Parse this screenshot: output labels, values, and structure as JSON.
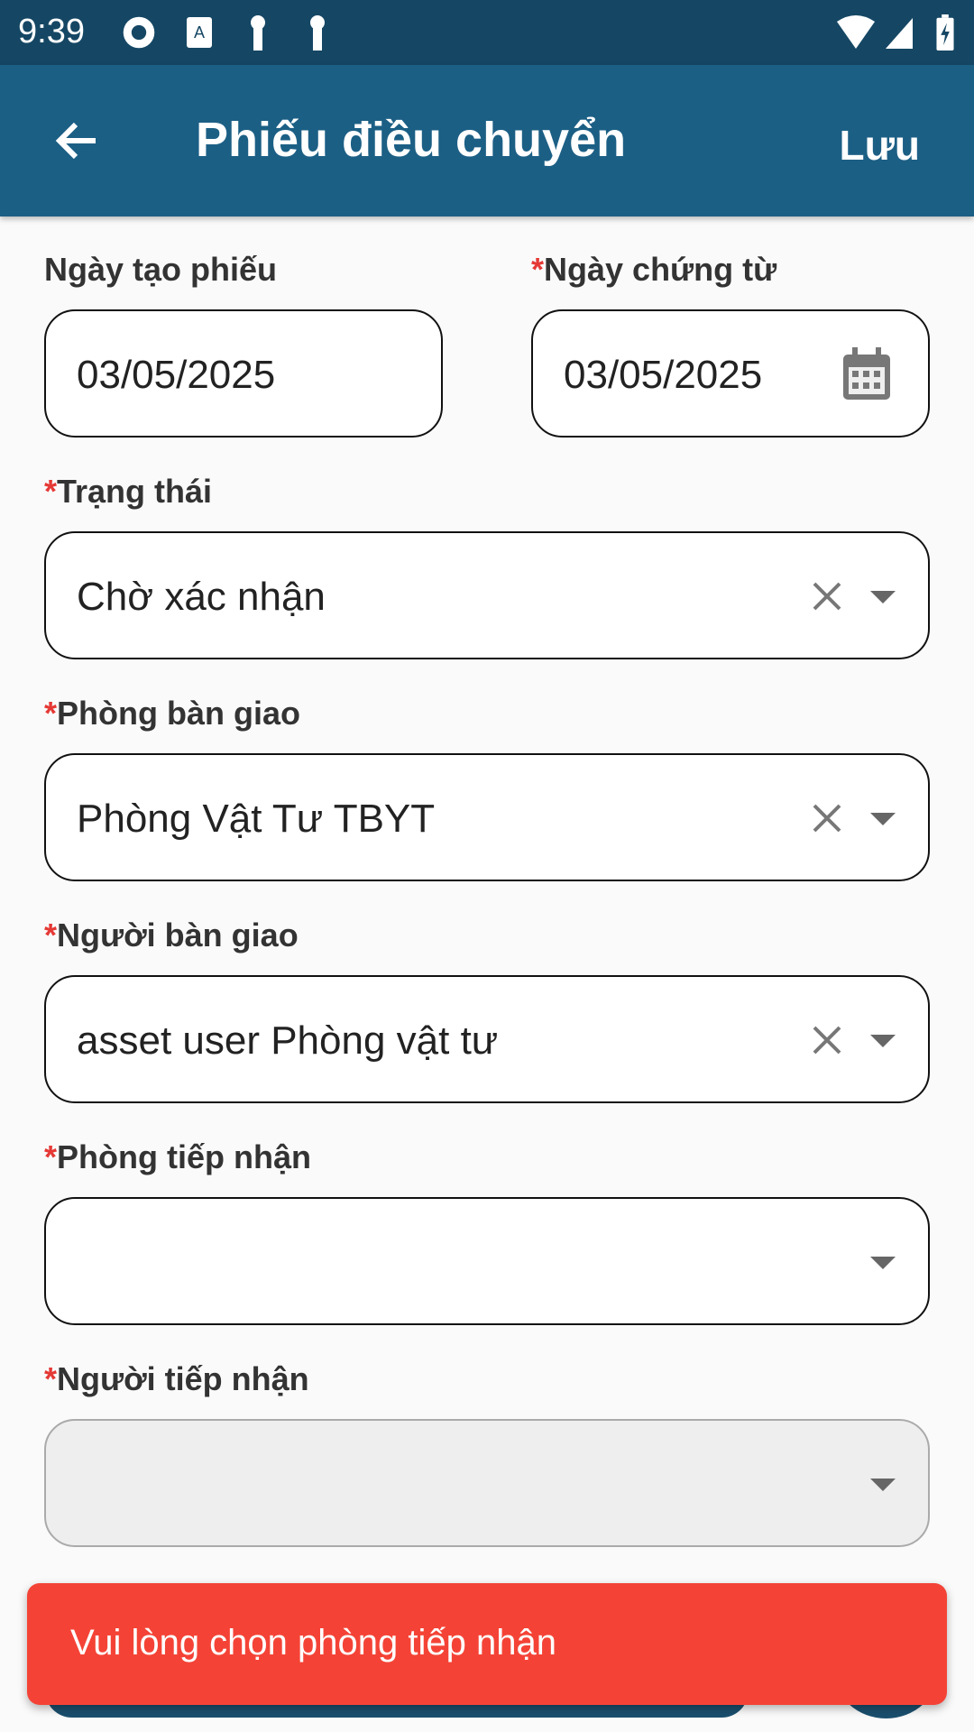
{
  "status_bar": {
    "time": "9:39"
  },
  "app_bar": {
    "title": "Phiếu điều chuyển",
    "save_label": "Lưu"
  },
  "form": {
    "required_mark": "*",
    "created_date": {
      "label": "Ngày tạo phiếu",
      "value": "03/05/2025"
    },
    "document_date": {
      "label": "Ngày chứng từ",
      "value": "03/05/2025"
    },
    "status": {
      "label": "Trạng thái",
      "value": "Chờ xác nhận"
    },
    "handover_dept": {
      "label": "Phòng bàn giao",
      "value": "Phòng Vật Tư TBYT"
    },
    "handover_person": {
      "label": "Người bàn giao",
      "value": "asset user Phòng vật tư"
    },
    "receiving_dept": {
      "label": "Phòng tiếp nhận",
      "value": ""
    },
    "receiving_person": {
      "label": "Người tiếp nhận",
      "value": ""
    }
  },
  "toast": {
    "message": "Vui lòng chọn phòng tiếp nhận",
    "color": "#f44336"
  }
}
